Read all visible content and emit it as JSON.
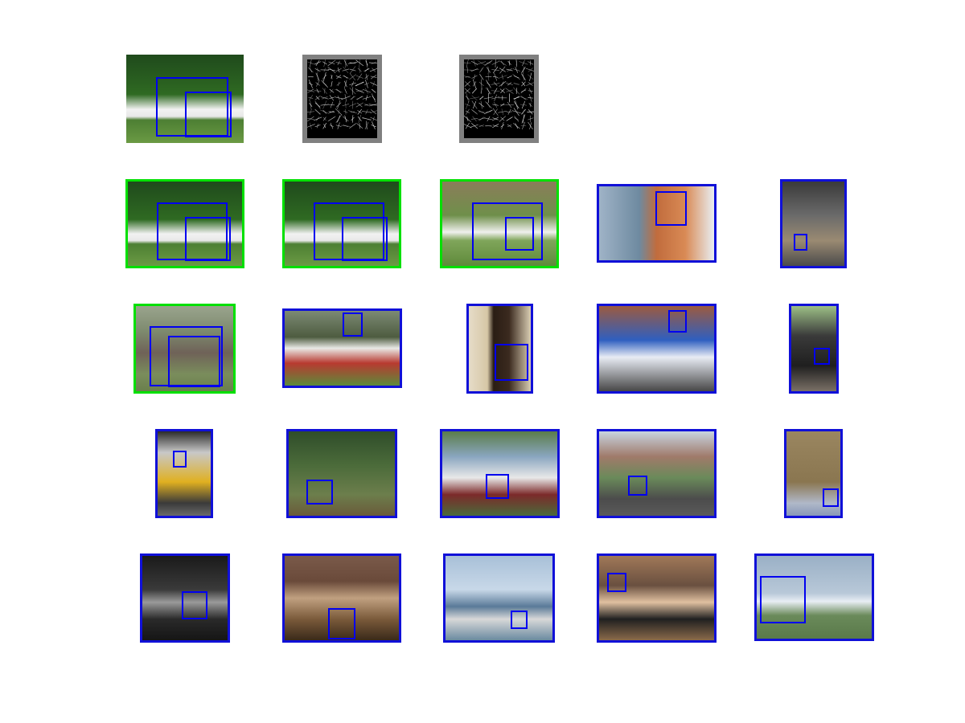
{
  "figure": {
    "rows": [
      {
        "name": "query-row",
        "tiles": [
          {
            "kind": "query",
            "scene": "horse-dark-green",
            "frame": "query"
          },
          {
            "kind": "hog",
            "scene": "hog-template-1",
            "frame": "hog"
          },
          {
            "kind": "hog",
            "scene": "hog-template-2",
            "frame": "hog"
          }
        ]
      },
      {
        "name": "results-row-1",
        "tiles": [
          {
            "kind": "result",
            "scene": "horse-dark-green",
            "frame": "match"
          },
          {
            "kind": "result",
            "scene": "horse-dark-green",
            "frame": "match"
          },
          {
            "kind": "result",
            "scene": "horse-brown-field",
            "frame": "match"
          },
          {
            "kind": "result",
            "scene": "potted-plant",
            "frame": "neg"
          },
          {
            "kind": "result",
            "scene": "dog-crate",
            "frame": "neg"
          }
        ]
      },
      {
        "name": "results-row-2",
        "tiles": [
          {
            "kind": "result",
            "scene": "two-horses",
            "frame": "match"
          },
          {
            "kind": "result",
            "scene": "white-car",
            "frame": "neg"
          },
          {
            "kind": "result",
            "scene": "rocking-chair",
            "frame": "neg"
          },
          {
            "kind": "result",
            "scene": "blue-motorbike",
            "frame": "neg"
          },
          {
            "kind": "result",
            "scene": "steam-train",
            "frame": "neg"
          }
        ]
      },
      {
        "name": "results-row-3",
        "tiles": [
          {
            "kind": "result",
            "scene": "yellow-train",
            "frame": "neg"
          },
          {
            "kind": "result",
            "scene": "egret-water",
            "frame": "neg"
          },
          {
            "kind": "result",
            "scene": "shark-statue-people",
            "frame": "neg"
          },
          {
            "kind": "result",
            "scene": "cyclists-street",
            "frame": "neg"
          },
          {
            "kind": "result",
            "scene": "bed-foot",
            "frame": "neg"
          }
        ]
      },
      {
        "name": "results-row-4",
        "tiles": [
          {
            "kind": "result",
            "scene": "dark-tv-room",
            "frame": "neg"
          },
          {
            "kind": "result",
            "scene": "people-sofa",
            "frame": "neg"
          },
          {
            "kind": "result",
            "scene": "seagull",
            "frame": "neg"
          },
          {
            "kind": "result",
            "scene": "bald-man-dining",
            "frame": "neg"
          },
          {
            "kind": "result",
            "scene": "white-jet",
            "frame": "neg"
          }
        ]
      }
    ],
    "colors": {
      "match_border": "#00e000",
      "negative_border": "#1010d8",
      "detection_box": "#0000f0",
      "hog_frame": "#808080"
    }
  }
}
